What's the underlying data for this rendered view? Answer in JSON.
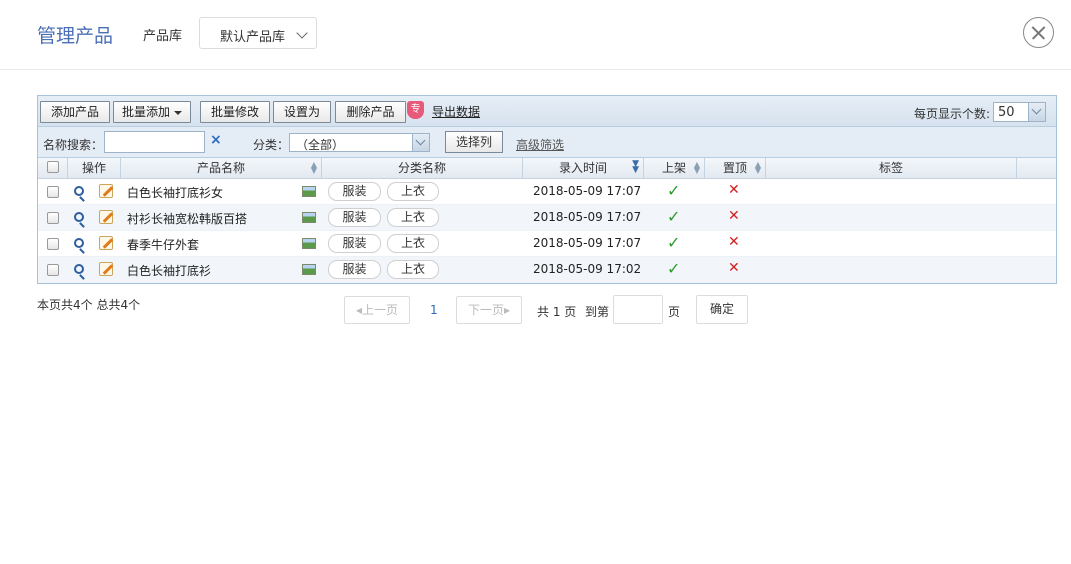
{
  "header": {
    "title": "管理产品",
    "library_label": "产品库",
    "library_value": "默认产品库"
  },
  "toolbar": {
    "add_product": "添加产品",
    "batch_add": "批量添加",
    "batch_edit": "批量修改",
    "set_as": "设置为",
    "delete_product": "删除产品",
    "export_badge": "专",
    "export_data": "导出数据",
    "per_page_label": "每页显示个数:",
    "per_page_value": "50"
  },
  "search": {
    "name_label": "名称搜索：",
    "clear_icon": "×",
    "category_label": "分类：",
    "category_value": "（全部）",
    "select_columns": "选择列",
    "advanced_filter": "高级筛选"
  },
  "table": {
    "headers": {
      "ops": "操作",
      "name": "产品名称",
      "category": "分类名称",
      "time": "录入时间",
      "listed": "上架",
      "top": "置顶",
      "tags": "标签"
    },
    "rows": [
      {
        "name": "白色长袖打底衫女",
        "tag1": "服装",
        "tag2": "上衣",
        "time": "2018-05-09 17:07",
        "listed": "✓",
        "top": "✕"
      },
      {
        "name": "衬衫长袖宽松韩版百搭",
        "tag1": "服装",
        "tag2": "上衣",
        "time": "2018-05-09 17:07",
        "listed": "✓",
        "top": "✕"
      },
      {
        "name": "春季牛仔外套",
        "tag1": "服装",
        "tag2": "上衣",
        "time": "2018-05-09 17:07",
        "listed": "✓",
        "top": "✕"
      },
      {
        "name": "白色长袖打底衫",
        "tag1": "服装",
        "tag2": "上衣",
        "time": "2018-05-09 17:02",
        "listed": "✓",
        "top": "✕"
      }
    ]
  },
  "pagination": {
    "summary": "本页共4个 总共4个",
    "prev": "上一页",
    "current": "1",
    "next": "下一页",
    "total": "共 1 页",
    "goto_label": "到第",
    "page_unit": "页",
    "confirm": "确定"
  },
  "colors": {
    "accent": "#4a6fb5",
    "listed_check": "#2c9a2c",
    "top_cross": "#d42020"
  }
}
